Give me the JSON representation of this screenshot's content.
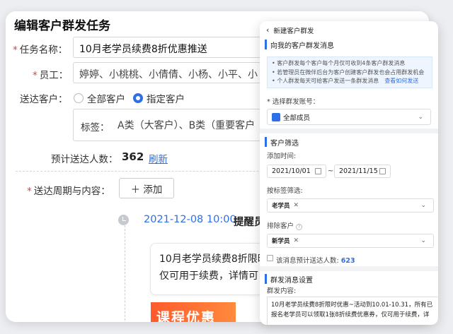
{
  "page": {
    "title": "编辑客户群发任务",
    "task_name_label": "任务名称：",
    "task_name_value": "10月老学员续费8折优惠推送",
    "staff_label": "员工：",
    "staff_value": "婷婷、小桃桃、小倩倩、小杨、小平、小",
    "send_to_label": "送达客户：",
    "radio_all": "全部客户",
    "radio_specified": "指定客户",
    "tag_label": "标签：",
    "tag_value": "A类（大客户）、B类（重要客户",
    "estimate_label": "预计送达人数：",
    "estimate_value": "362",
    "refresh": "刷新",
    "cycle_label": "送达周期与内容：",
    "add_button": "＋ 添加",
    "timeline_date": "2021-12-08 10:00",
    "timeline_remind": "提醒员",
    "message_line1": "10月老学员续费8折限时",
    "message_line2": "仅可用于续费，详情可",
    "promo_text": "课程优惠"
  },
  "panel": {
    "back_title": "新建客户群发",
    "section_info": "向我的客户群发消息",
    "notice_line1": "• 客户群发每个客户每个月仅可收到4条客户群发消息",
    "notice_line2": "• 若管理员在微伴后台为客户创建客户群发也会占用群发机会",
    "notice_line3": "• 个人群发每天可给客户发送一条群发消息",
    "notice_link": "查看如何发送",
    "account_label": "* 选择群发账号：",
    "account_value": "全部成员",
    "section_filter": "客户筛选",
    "add_time_label": "添加时间:",
    "date_start": "2021/10/01",
    "date_sep": "~",
    "date_end": "2021/11/15",
    "tag_filter_label": "按标签筛选:",
    "tag_chip": "老学员",
    "exclude_label": "排除客户",
    "exclude_chip": "新学员",
    "estimate_text": "该消息预计送达人数:",
    "estimate_value": "623",
    "section_settings": "群发消息设置",
    "content_label": "群发内容:",
    "content_line1": "10月老学员续费8折限时优惠~活动到10.01-10.31，所有已",
    "content_line2": "报名老学员可以领取1张8折续费优惠券，仅可用于续费，详"
  },
  "colors": {
    "accent": "#2d6fe6",
    "required": "#e23c3c",
    "promo": "#ff5a2b"
  }
}
